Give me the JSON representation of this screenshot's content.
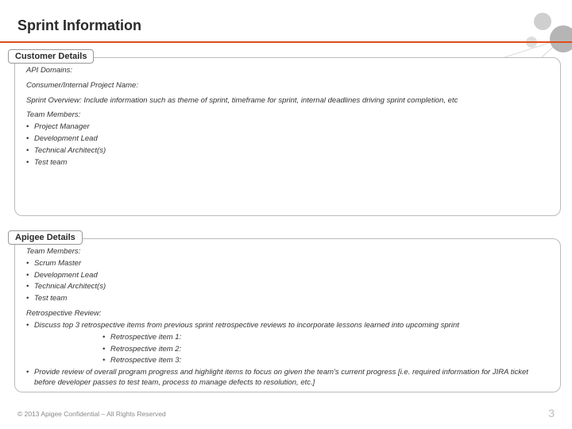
{
  "title": "Sprint Information",
  "section1": {
    "tab": "Customer Details",
    "api_domains": "API Domains:",
    "project_name": "Consumer/Internal Project Name:",
    "sprint_overview": "Sprint Overview: Include information such as theme of sprint, timeframe for sprint, internal deadlines driving sprint completion, etc",
    "team_heading": "Team Members:",
    "members": {
      "m0": "Project Manager",
      "m1": "Development Lead",
      "m2": "Technical Architect(s)",
      "m3": "Test team"
    }
  },
  "section2": {
    "tab": "Apigee Details",
    "team_heading": "Team Members:",
    "members": {
      "m0": "Scrum Master",
      "m1": "Development Lead",
      "m2": "Technical Architect(s)",
      "m3": "Test team"
    },
    "retro_heading": "Retrospective Review:",
    "retro_b1": "Discuss top 3 retrospective items from previous sprint retrospective reviews to incorporate lessons learned into upcoming sprint",
    "retro_items": {
      "i0": "Retrospective item 1:",
      "i1": "Retrospective item 2:",
      "i2": "Retrospective item 3:"
    },
    "retro_b2": "Provide review of overall program progress and highlight items to focus on given the team's current progress [i.e. required information for JIRA ticket before developer passes to test team, process to manage defects to resolution, etc.]"
  },
  "footer": "© 2013 Apigee Confidential – All Rights Reserved",
  "page_number": "3",
  "bullet": "•"
}
